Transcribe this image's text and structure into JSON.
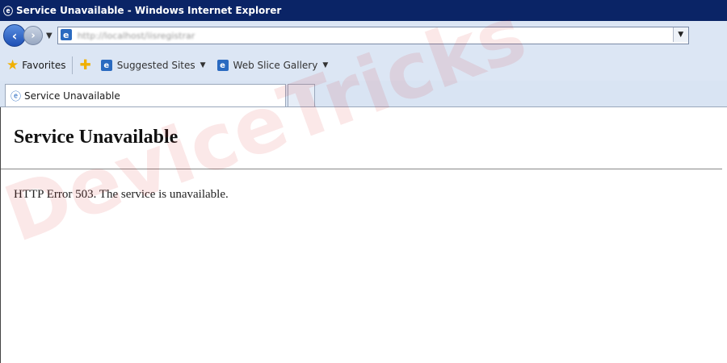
{
  "window": {
    "title": "Service Unavailable - Windows Internet Explorer"
  },
  "address_bar": {
    "url": "http://localhost/iisregistrar",
    "icon": "ie-page-icon"
  },
  "favorites_bar": {
    "favorites_label": "Favorites",
    "items": [
      {
        "label": "Suggested Sites",
        "icon": "ie-page-icon"
      },
      {
        "label": "Web Slice Gallery",
        "icon": "ie-page-icon"
      }
    ]
  },
  "tabs": [
    {
      "label": "Service Unavailable",
      "icon": "ie-page-icon"
    }
  ],
  "page": {
    "heading": "Service Unavailable",
    "message": "HTTP Error 503. The service is unavailable."
  },
  "watermark": {
    "text": "DeviceTricks"
  },
  "colors": {
    "title_bar": "#0a2466",
    "chrome": "#dce6f4",
    "watermark": "#dc1e1e"
  }
}
